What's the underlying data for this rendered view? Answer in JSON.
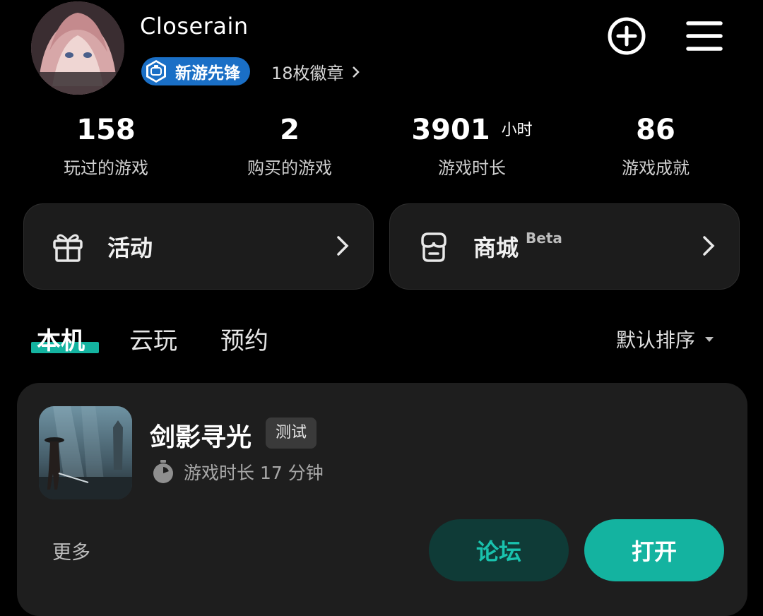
{
  "profile": {
    "username": "Closerain",
    "badge_label": "新游先锋",
    "badge_count": "18枚徽章"
  },
  "header_actions": {
    "add": "add-circle-icon",
    "menu": "hamburger-menu-icon"
  },
  "stats": [
    {
      "value": "158",
      "unit": "",
      "label": "玩过的游戏"
    },
    {
      "value": "2",
      "unit": "",
      "label": "购买的游戏"
    },
    {
      "value": "3901",
      "unit": "小时",
      "label": "游戏时长"
    },
    {
      "value": "86",
      "unit": "",
      "label": "游戏成就"
    }
  ],
  "cards": {
    "activity": {
      "label": "活动",
      "icon": "gift-icon"
    },
    "store": {
      "label": "商城",
      "beta": "Beta",
      "icon": "store-icon"
    }
  },
  "tabs": [
    {
      "label": "本机",
      "active": true
    },
    {
      "label": "云玩",
      "active": false
    },
    {
      "label": "预约",
      "active": false
    }
  ],
  "sort": {
    "label": "默认排序"
  },
  "game": {
    "title": "剑影寻光",
    "tag": "测试",
    "playtime": "游戏时长 17 分钟",
    "more": "更多",
    "forum_button": "论坛",
    "open_button": "打开"
  },
  "colors": {
    "accent": "#14b3a0",
    "badge_blue": "#1a6fc6",
    "card_bg": "#1c1c1c",
    "background": "#000000"
  }
}
